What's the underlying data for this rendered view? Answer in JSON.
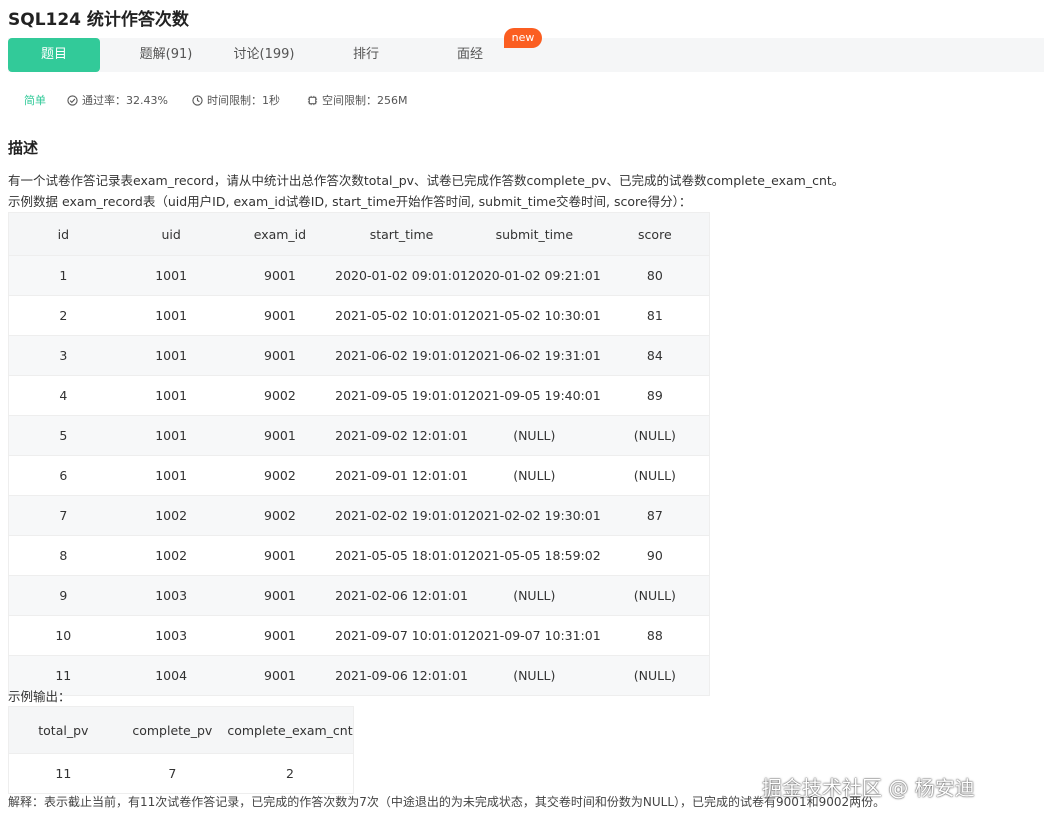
{
  "header": {
    "title": "SQL124  统计作答次数"
  },
  "tabs": [
    {
      "label": "题目"
    },
    {
      "label": "题解(91)"
    },
    {
      "label": "讨论(199)"
    },
    {
      "label": "排行"
    },
    {
      "label": "面经"
    }
  ],
  "new_badge": "new",
  "meta": {
    "difficulty": "简单",
    "pass_rate": "通过率：32.43%",
    "time_limit": "时间限制：1秒",
    "space_limit": "空间限制：256M"
  },
  "description": {
    "heading": "描述",
    "line1": "有一个试卷作答记录表exam_record，请从中统计出总作答次数total_pv、试卷已完成作答数complete_pv、已完成的试卷数complete_exam_cnt。",
    "line2": "示例数据 exam_record表（uid用户ID, exam_id试卷ID, start_time开始作答时间, submit_time交卷时间, score得分）："
  },
  "table1": {
    "headers": [
      "id",
      "uid",
      "exam_id",
      "start_time",
      "submit_time",
      "score"
    ],
    "rows": [
      [
        "1",
        "1001",
        "9001",
        "2020-01-02 09:01:01",
        "2020-01-02 09:21:01",
        "80"
      ],
      [
        "2",
        "1001",
        "9001",
        "2021-05-02 10:01:01",
        "2021-05-02 10:30:01",
        "81"
      ],
      [
        "3",
        "1001",
        "9001",
        "2021-06-02 19:01:01",
        "2021-06-02 19:31:01",
        "84"
      ],
      [
        "4",
        "1001",
        "9002",
        "2021-09-05 19:01:01",
        "2021-09-05 19:40:01",
        "89"
      ],
      [
        "5",
        "1001",
        "9001",
        "2021-09-02 12:01:01",
        "(NULL)",
        "(NULL)"
      ],
      [
        "6",
        "1001",
        "9002",
        "2021-09-01 12:01:01",
        "(NULL)",
        "(NULL)"
      ],
      [
        "7",
        "1002",
        "9002",
        "2021-02-02 19:01:01",
        "2021-02-02 19:30:01",
        "87"
      ],
      [
        "8",
        "1002",
        "9001",
        "2021-05-05 18:01:01",
        "2021-05-05 18:59:02",
        "90"
      ],
      [
        "9",
        "1003",
        "9001",
        "2021-02-06 12:01:01",
        "(NULL)",
        "(NULL)"
      ],
      [
        "10",
        "1003",
        "9001",
        "2021-09-07 10:01:01",
        "2021-09-07 10:31:01",
        "88"
      ],
      [
        "11",
        "1004",
        "9001",
        "2021-09-06 12:01:01",
        "(NULL)",
        "(NULL)"
      ]
    ]
  },
  "output_label": "示例输出：",
  "table2": {
    "headers": [
      "total_pv",
      "complete_pv",
      "complete_exam_cnt"
    ],
    "rows": [
      [
        "11",
        "7",
        "2"
      ]
    ]
  },
  "explanation": "解释：表示截止当前，有11次试卷作答记录，已完成的作答次数为7次（中途退出的为未完成状态，其交卷时间和份数为NULL），已完成的试卷有9001和9002两份。",
  "watermark": "掘金技术社区 @ 杨安迪",
  "colors": {
    "accent": "#32ca99",
    "badge": "#fb5e21"
  }
}
